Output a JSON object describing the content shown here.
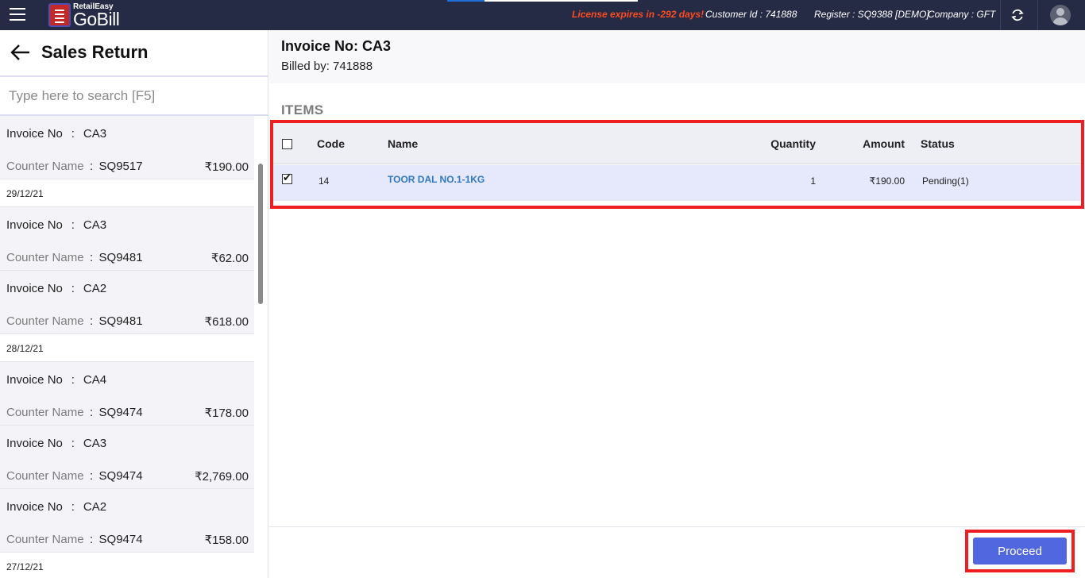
{
  "topbar": {
    "logo_small": "RetailEasy",
    "logo_big": "GoBill",
    "license_text": "License expires in -292 days!",
    "customer_id": "Customer Id : 741888",
    "register": "Register : SQ9388 [DEMO]",
    "company": "Company : GFT"
  },
  "sidebar": {
    "title": "Sales Return",
    "search_placeholder": "Type here to search [F5]",
    "invoice_label": "Invoice No",
    "counter_label": "Counter Name",
    "separator": ":",
    "entries": [
      {
        "invoice": "CA3",
        "counter": "SQ9517",
        "amount": "₹190.00"
      },
      {
        "date": "29/12/21"
      },
      {
        "invoice": "CA3",
        "counter": "SQ9481",
        "amount": "₹62.00"
      },
      {
        "invoice": "CA2",
        "counter": "SQ9481",
        "amount": "₹618.00"
      },
      {
        "date": "28/12/21"
      },
      {
        "invoice": "CA4",
        "counter": "SQ9474",
        "amount": "₹178.00"
      },
      {
        "invoice": "CA3",
        "counter": "SQ9474",
        "amount": "₹2,769.00"
      },
      {
        "invoice": "CA2",
        "counter": "SQ9474",
        "amount": "₹158.00"
      },
      {
        "date": "27/12/21"
      }
    ]
  },
  "main": {
    "invoice_title": "Invoice No: CA3",
    "billed_by": "Billed by: 741888",
    "items_label": "ITEMS",
    "columns": {
      "code": "Code",
      "name": "Name",
      "quantity": "Quantity",
      "amount": "Amount",
      "status": "Status"
    },
    "rows": [
      {
        "checked": true,
        "code": "14",
        "name": "TOOR DAL NO.1-1KG",
        "quantity": "1",
        "amount": "₹190.00",
        "status": "Pending(1)"
      }
    ],
    "proceed_label": "Proceed"
  },
  "colors": {
    "topbar": "#252a45",
    "license": "#ff4b1f",
    "highlight_frame": "#ee1f23",
    "proceed": "#5167e0",
    "item_link": "#2f78c4"
  },
  "icons": [
    "hamburger-menu-icon",
    "gobill-logo-icon",
    "refresh-icon",
    "user-avatar-icon",
    "back-arrow-icon",
    "checkbox-icon"
  ]
}
